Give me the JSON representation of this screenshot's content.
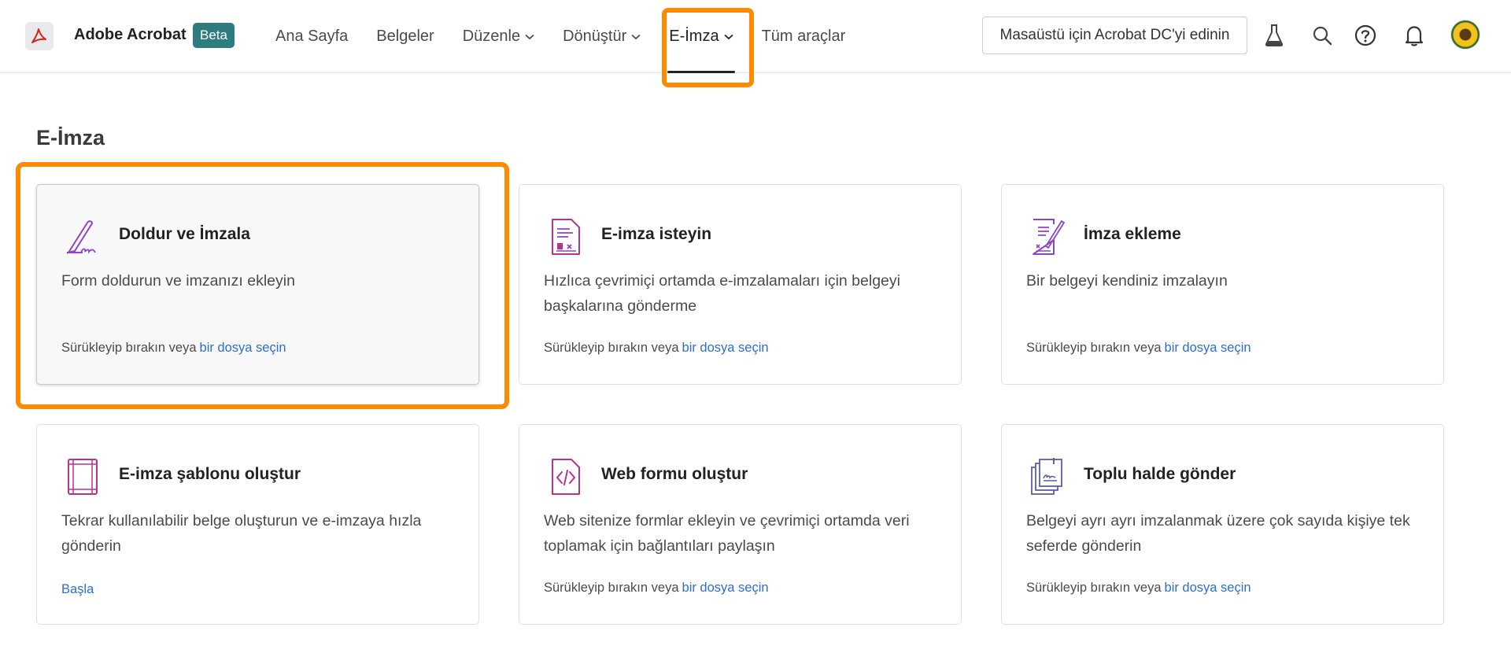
{
  "header": {
    "app_name": "Adobe Acrobat",
    "beta_label": "Beta",
    "nav": [
      {
        "label": "Ana Sayfa",
        "dropdown": false
      },
      {
        "label": "Belgeler",
        "dropdown": false
      },
      {
        "label": "Düzenle",
        "dropdown": true
      },
      {
        "label": "Dönüştür",
        "dropdown": true
      },
      {
        "label": "E-İmza",
        "dropdown": true,
        "active": true
      },
      {
        "label": "Tüm araçlar",
        "dropdown": false
      }
    ],
    "get_desktop_label": "Masaüstü için Acrobat DC'yi edinin",
    "icons": [
      "flask-icon",
      "search-icon",
      "help-icon",
      "bell-icon",
      "avatar"
    ]
  },
  "page": {
    "title": "E-İmza"
  },
  "cards": [
    {
      "title": "Doldur ve İmzala",
      "desc": "Form doldurun ve imzanızı ekleyin",
      "drop_text": "Sürükleyip bırakın veya",
      "link_text": "bir dosya seçin",
      "icon": "fill-sign-icon"
    },
    {
      "title": "E-imza isteyin",
      "desc": "Hızlıca çevrimiçi ortamda e-imzalamaları için belgeyi başkalarına gönderme",
      "drop_text": "Sürükleyip bırakın veya",
      "link_text": "bir dosya seçin",
      "icon": "request-signature-icon"
    },
    {
      "title": "İmza ekleme",
      "desc": "Bir belgeyi kendiniz imzalayın",
      "drop_text": "Sürükleyip bırakın veya",
      "link_text": "bir dosya seçin",
      "icon": "add-signature-icon"
    },
    {
      "title": "E-imza şablonu oluştur",
      "desc": "Tekrar kullanılabilir belge oluşturun ve e-imzaya hızla gönderin",
      "start_text": "Başla",
      "icon": "template-icon"
    },
    {
      "title": "Web formu oluştur",
      "desc": "Web sitenize formlar ekleyin ve çevrimiçi ortamda veri toplamak için bağlantıları paylaşın",
      "drop_text": "Sürükleyip bırakın veya",
      "link_text": "bir dosya seçin",
      "icon": "web-form-icon"
    },
    {
      "title": "Toplu halde gönder",
      "desc": "Belgeyi ayrı ayrı imzalanmak üzere çok sayıda kişiye tek seferde gönderin",
      "drop_text": "Sürükleyip bırakın veya",
      "link_text": "bir dosya seçin",
      "icon": "bulk-send-icon"
    }
  ],
  "colors": {
    "accent_highlight": "#ff8a00",
    "link": "#2c6fcf",
    "beta_badge": "#2d7d80",
    "icon_purple": "#8e44c8",
    "icon_magenta": "#b5348f"
  }
}
